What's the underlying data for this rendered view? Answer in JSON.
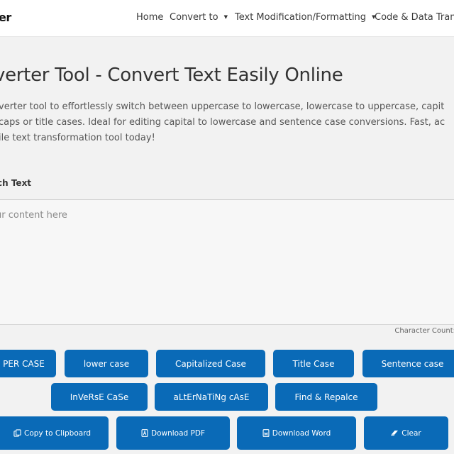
{
  "header": {
    "logo_text": "er",
    "nav": [
      {
        "label": "Home",
        "has_dropdown": false
      },
      {
        "label": "Convert to",
        "has_dropdown": true
      },
      {
        "label": "Text Modification/Formatting",
        "has_dropdown": true
      },
      {
        "label": "Code & Data Transla",
        "has_dropdown": false
      }
    ],
    "caret_glyph": "▼"
  },
  "main": {
    "title": "verter Tool - Convert Text Easily Online",
    "description_lines": [
      "verter tool to effortlessly switch between uppercase to lowercase, lowercase to uppercase, capit",
      "caps or title cases. Ideal for editing capital to lowercase and sentence case conversions. Fast, ac",
      "ile text transformation tool today!"
    ],
    "field_label": "ch Text",
    "textarea": {
      "value": "",
      "placeholder": "ur content here"
    },
    "character_count_label": "Character Count:"
  },
  "case_buttons_row1": [
    {
      "label": "PER CASE"
    },
    {
      "label": "lower case"
    },
    {
      "label": "Capitalized Case"
    },
    {
      "label": "Title Case"
    },
    {
      "label": "Sentence case"
    }
  ],
  "case_buttons_row2": [
    {
      "label": "InVeRsE CaSe"
    },
    {
      "label": "aLtErNaTiNg cAsE"
    },
    {
      "label": "Find & Repalce"
    }
  ],
  "action_buttons": [
    {
      "label": "Copy to Clipboard",
      "icon": "copy-icon"
    },
    {
      "label": "Download PDF",
      "icon": "pdf-file-icon"
    },
    {
      "label": "Download Word",
      "icon": "word-file-icon"
    },
    {
      "label": "Clear",
      "icon": "eraser-icon"
    }
  ],
  "colors": {
    "button_bg": "#0a6ab7",
    "button_text": "#ffffff",
    "page_bg": "#f2f2f2",
    "header_bg": "#ffffff"
  }
}
